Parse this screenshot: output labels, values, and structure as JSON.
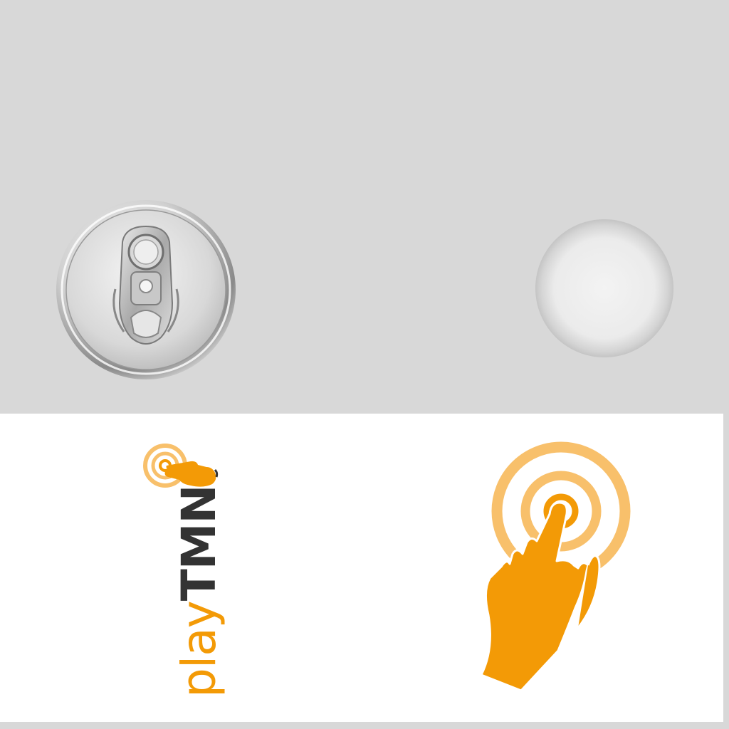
{
  "colors": {
    "top_background": "#d8d8d8",
    "bottom_background": "#ffffff",
    "brand_orange": "#f39a06",
    "brand_orange_light": "#f8c06b",
    "wordmark_dark": "#333333",
    "metal_light": "#f2f2f2",
    "metal_dark": "#8c8c8c"
  },
  "top_panel": {
    "can_lid": {
      "icon": "can-pull-tab-icon"
    },
    "bubble": {
      "icon": "round-button-icon"
    }
  },
  "bottom_panel": {
    "logo": {
      "icon": "touch-ripple-hand-icon",
      "word_play": "play",
      "word_tmn": "TMN"
    },
    "touch_icon": {
      "icon": "touch-target-hand-icon"
    }
  }
}
